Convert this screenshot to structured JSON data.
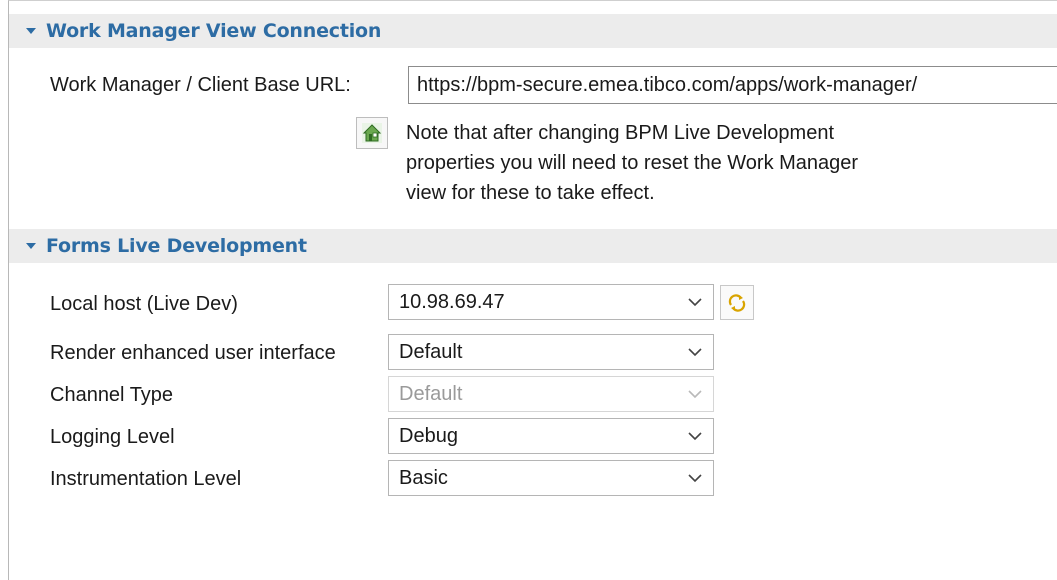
{
  "sections": {
    "work_manager": {
      "title": "Work Manager View Connection",
      "url_label": "Work Manager / Client Base URL:",
      "url_value": "https://bpm-secure.emea.tibco.com/apps/work-manager/",
      "note_lines": [
        "Note that after changing BPM Live Development",
        "properties you will need to reset the Work Manager",
        "view for these to take effect."
      ],
      "note_icon": "home-info-icon"
    },
    "forms_live": {
      "title": "Forms Live Development",
      "fields": [
        {
          "label": "Local host (Live Dev)",
          "value": "10.98.69.47",
          "enabled": true
        },
        {
          "label": "Render enhanced user interface",
          "value": "Default",
          "enabled": true
        },
        {
          "label": "Channel Type",
          "value": "Default",
          "enabled": false
        },
        {
          "label": "Logging Level",
          "value": "Debug",
          "enabled": true
        },
        {
          "label": "Instrumentation Level",
          "value": "Basic",
          "enabled": true
        }
      ],
      "refresh_icon": "refresh-icon"
    }
  },
  "colors": {
    "section_title": "#2d6ca4",
    "section_header_bg": "#ececec",
    "text": "#1a1a1a",
    "disabled_text": "#9a9a9a"
  }
}
